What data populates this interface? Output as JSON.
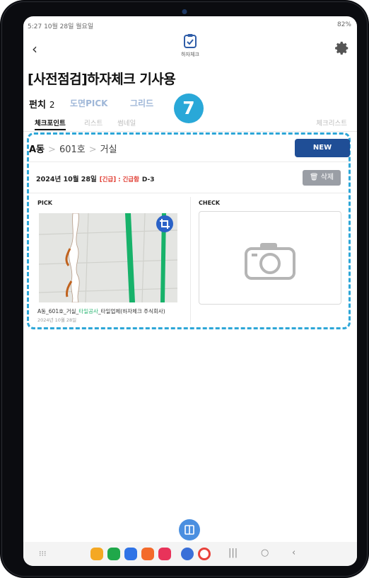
{
  "status_bar": {
    "left": "5:27  10월 28일 월요일",
    "right": "82%"
  },
  "header": {
    "logo_label": "하자체크"
  },
  "page_title": "[사전점검]하자체크 기사용",
  "tabs": [
    {
      "label": "펀치",
      "count": "2"
    },
    {
      "label": "도면PICK"
    },
    {
      "label": "그리드"
    }
  ],
  "step_badge": "7",
  "subtabs": [
    "체크포인트",
    "리스트",
    "썸네일",
    "체크리스트"
  ],
  "breadcrumb": {
    "dong": "A동",
    "unit": "601호",
    "room": "거실"
  },
  "new_button": "NEW",
  "item": {
    "date": "2024년 10월 28일",
    "urgent": "[긴급] : 긴급함",
    "dday": "D-3",
    "delete_label": "삭제",
    "pick_label": "PICK",
    "check_label": "CHECK",
    "caption_prefix": "A동_601호_거실_",
    "caption_highlight": "타일공사",
    "caption_suffix": "_타일업체(하자체크 주식회사)",
    "caption_date": "2024년 10월 28일"
  },
  "colors": {
    "accent": "#29a8d8",
    "primary": "#1f4e96",
    "urgent": "#e03a2f",
    "highlight": "#2bb673"
  }
}
